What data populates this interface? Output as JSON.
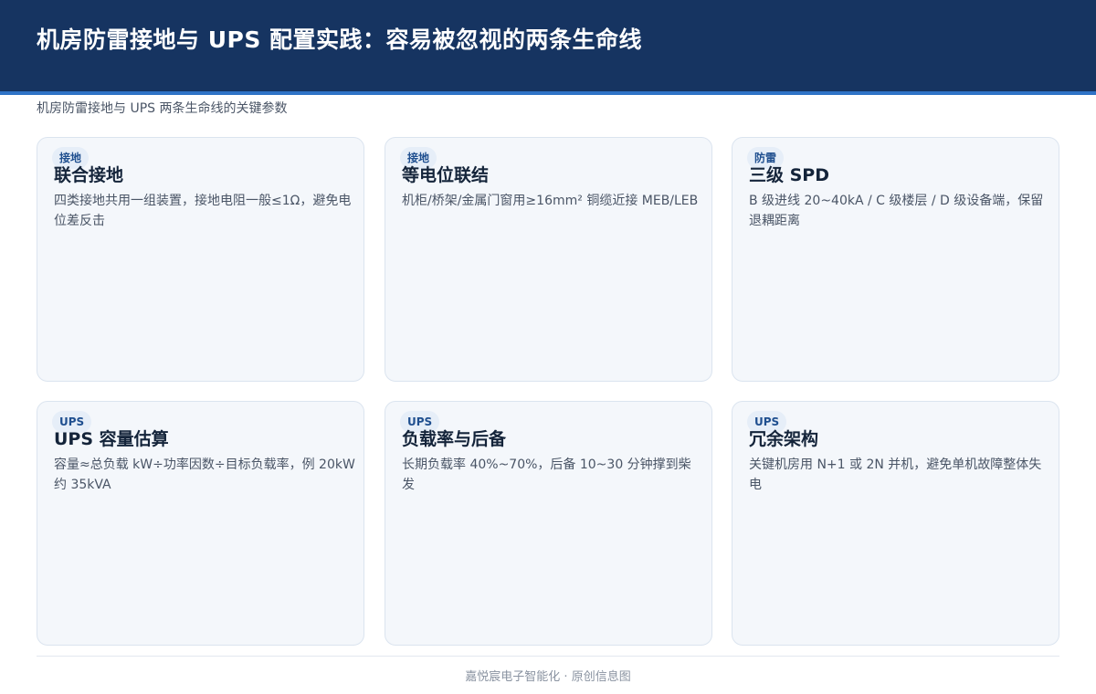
{
  "header": {
    "title": "机房防雷接地与 UPS 配置实践：容易被忽视的两条生命线",
    "subtitle": "机房防雷接地与 UPS 两条生命线的关键参数"
  },
  "cards": [
    {
      "tag": "接地",
      "title": "联合接地",
      "desc": "四类接地共用一组装置，接地电阻一般≤1Ω，避免电位差反击"
    },
    {
      "tag": "接地",
      "title": "等电位联结",
      "desc": "机柜/桥架/金属门窗用≥16mm² 铜缆近接 MEB/LEB"
    },
    {
      "tag": "防雷",
      "title": "三级 SPD",
      "desc": "B 级进线 20~40kA / C 级楼层 / D 级设备端，保留退耦距离"
    },
    {
      "tag": "UPS",
      "title": "UPS 容量估算",
      "desc": "容量≈总负载 kW÷功率因数÷目标负载率，例 20kW 约 35kVA"
    },
    {
      "tag": "UPS",
      "title": "负载率与后备",
      "desc": "长期负载率 40%~70%，后备 10~30 分钟撑到柴发"
    },
    {
      "tag": "UPS",
      "title": "冗余架构",
      "desc": "关键机房用 N+1 或 2N 并机，避免单机故障整体失电"
    }
  ],
  "footer": {
    "text": "嘉悦宸电子智能化 · 原创信息图"
  },
  "colors": {
    "header_bg": "#163461",
    "accent": "#2f73c6",
    "card_bg": "#f4f7fb",
    "card_border": "#dbe4ef",
    "tag_text": "#1f4f8f"
  }
}
